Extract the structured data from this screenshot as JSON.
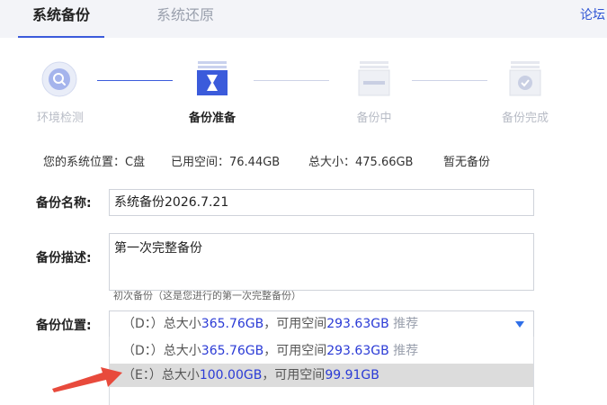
{
  "tabs": {
    "backup": "系统备份",
    "restore": "系统还原"
  },
  "forum_link": "论坛",
  "steps": [
    {
      "label": "环境检测",
      "state": "done",
      "icon": "search-icon"
    },
    {
      "label": "备份准备",
      "state": "active",
      "icon": "hourglass-icon"
    },
    {
      "label": "备份中",
      "state": "pending",
      "icon": "backup-drive-icon"
    },
    {
      "label": "备份完成",
      "state": "pending",
      "icon": "check-drive-icon"
    }
  ],
  "info": {
    "location": "您的系统位置：C盘",
    "used": "已用空间：76.44GB",
    "total": "总大小：475.66GB",
    "status": "暂无备份"
  },
  "form": {
    "name_label": "备份名称:",
    "name_value": "系统备份2026.7.21",
    "desc_label": "备份描述:",
    "desc_value": "第一次完整备份",
    "desc_hint": "初次备份（这是您进行的第一次完整备份）",
    "location_label": "备份位置:",
    "selected": {
      "drive": "（D：）",
      "total_prefix": "总大小",
      "total": "365.76GB",
      "free_prefix": "，可用空间",
      "free": "293.63GB",
      "tag": "推荐"
    },
    "options": [
      {
        "drive": "（D：）",
        "total_prefix": "总大小",
        "total": "365.76GB",
        "free_prefix": "，可用空间",
        "free": "293.63GB",
        "tag": "推荐"
      },
      {
        "drive": "（E：）",
        "total_prefix": "总大小",
        "total": "100.00GB",
        "free_prefix": "，可用空间",
        "free": "99.91GB",
        "tag": ""
      }
    ]
  },
  "colors": {
    "accent": "#3b5bdb",
    "value_blue": "#2b3bd6",
    "arrow_red": "#e84a3c",
    "highlight_row": "#dcdcdc"
  }
}
